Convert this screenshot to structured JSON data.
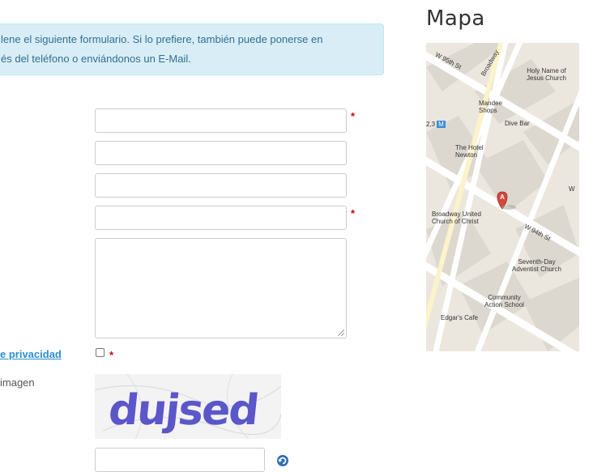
{
  "form": {
    "intro_line1": "lene el siguiente formulario. Si lo prefiere, también puede ponerse en",
    "intro_line2": "és del teléfono o enviándonos un E-Mail.",
    "required_mark": "*",
    "privacy_link": "e privacidad",
    "image_label": " imagen",
    "captcha_text": "dujsed",
    "refresh_icon": "refresh-icon"
  },
  "map": {
    "title": "Mapa",
    "marker": "A",
    "labels": {
      "w95": "W 95th St",
      "broadway": "Broadway",
      "holy1": "Holy Name of",
      "holy2": "Jesus Church",
      "mandee1": "Mandee",
      "mandee2": "Shops",
      "divebar": "Dive Bar",
      "subway": "2,3",
      "subway_m": "M",
      "hotel1": "The Hotel",
      "hotel2": "Newton",
      "buc1": "Broadway United",
      "buc2": "Church of Christ",
      "w94": "W 94th St",
      "sda1": "Seventh-Day",
      "sda2": "Adventist Church",
      "cas1": "Community",
      "cas2": "Action School",
      "edgar": "Edgar's Cafe",
      "w": "W"
    }
  }
}
